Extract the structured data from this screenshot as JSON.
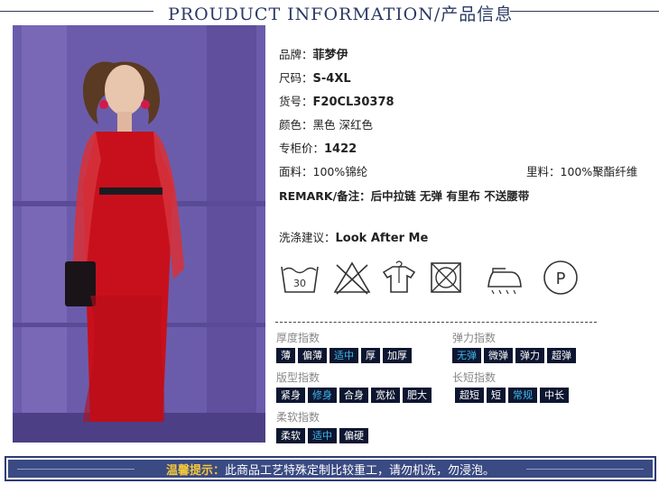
{
  "header": {
    "title": "PROUDUCT INFORMATION/产品信息"
  },
  "specs": {
    "brand_label": "品牌：",
    "brand": "菲梦伊",
    "size_label": "尺码：",
    "size": "S-4XL",
    "sku_label": "货号：",
    "sku": "F20CL30378",
    "color_label": "颜色：",
    "color": "黑色 深红色",
    "price_label": "专柜价：",
    "price": "1422",
    "fabric_label": "面料：",
    "fabric": "100%锦纶",
    "lining_label": "里料：",
    "lining": "100%聚酯纤维",
    "remark_label": "REMARK/备注：",
    "remark": "后中拉链 无弹 有里布 不送腰带",
    "wash_label": "洗涤建议：",
    "wash": "Look After Me"
  },
  "care_icons": [
    {
      "name": "wash-30-icon",
      "text": "30"
    },
    {
      "name": "no-bleach-icon",
      "text": ""
    },
    {
      "name": "hang-dry-icon",
      "text": ""
    },
    {
      "name": "no-tumble-dry-icon",
      "text": ""
    },
    {
      "name": "iron-icon",
      "text": ""
    },
    {
      "name": "dry-clean-p-icon",
      "text": "P"
    }
  ],
  "indices": {
    "thickness": {
      "title": "厚度指数",
      "options": [
        "薄",
        "偏薄",
        "适中",
        "厚",
        "加厚"
      ],
      "selected": "适中"
    },
    "elasticity": {
      "title": "弹力指数",
      "options": [
        "无弹",
        "微弹",
        "弹力",
        "超弹"
      ],
      "selected": "无弹"
    },
    "fit": {
      "title": "版型指数",
      "options": [
        "紧身",
        "修身",
        "合身",
        "宽松",
        "肥大"
      ],
      "selected": "修身"
    },
    "length": {
      "title": "长短指数",
      "options": [
        "超短",
        "短",
        "常规",
        "中长"
      ],
      "selected": "常规"
    },
    "softness": {
      "title": "柔软指数",
      "options": [
        "柔软",
        "适中",
        "偏硬"
      ],
      "selected": "适中"
    }
  },
  "footer": {
    "label": "温馨提示：",
    "text": "此商品工艺特殊定制比较重工，请勿机洗，勿浸泡。"
  },
  "colors": {
    "accent": "#3fb8ee",
    "chip_bg": "#0d1630",
    "footer_bg": "#3a4a82",
    "footer_label": "#f5c83a",
    "dress": "#c8101c"
  }
}
